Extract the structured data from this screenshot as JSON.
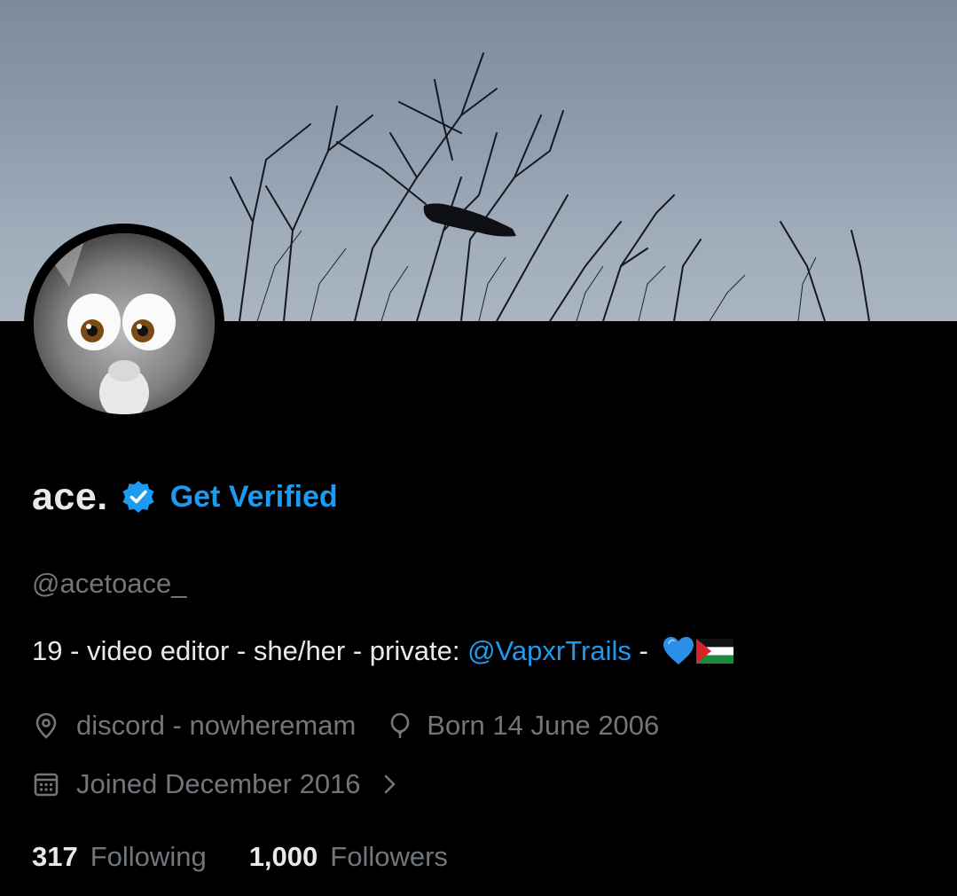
{
  "profile": {
    "display_name": "ace.",
    "verified_icon": "verified-badge-icon",
    "get_verified_label": "Get Verified",
    "handle": "@acetoace_",
    "bio": {
      "text_before": "19 - video editor - she/her - private: ",
      "mention": "@VapxrTrails",
      "text_after": " - ",
      "emoji_icons": [
        "blue-heart-icon",
        "palestine-flag-icon"
      ]
    },
    "location": "discord - nowheremam",
    "birthday": "Born 14 June 2006",
    "joined": "Joined December 2016",
    "following_count": "317",
    "following_label": "Following",
    "followers_count": "1,000",
    "followers_label": "Followers"
  },
  "colors": {
    "accent": "#1d9bf0",
    "muted_text": "#71767b",
    "primary_text": "#e7e9ea",
    "background": "#000000"
  }
}
